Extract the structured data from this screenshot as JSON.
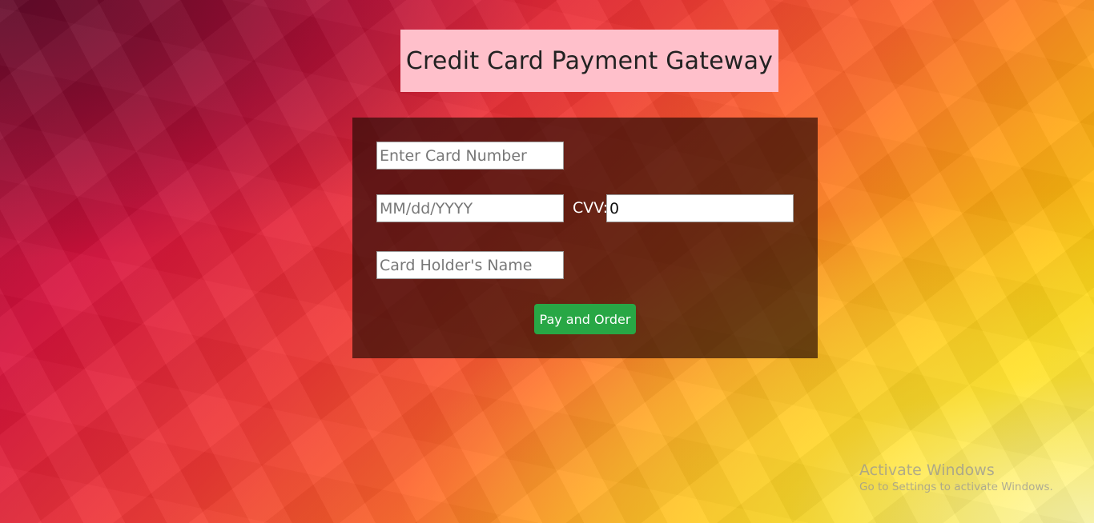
{
  "header": {
    "title": "Credit Card Payment Gateway"
  },
  "form": {
    "card_number": {
      "placeholder": "Enter Card Number",
      "value": ""
    },
    "expiry": {
      "placeholder": "MM/dd/YYYY",
      "value": ""
    },
    "cvv_label": "CVV:",
    "cvv": {
      "value": "0"
    },
    "holder_name": {
      "placeholder": "Card Holder's Name",
      "value": ""
    },
    "submit_label": "Pay and Order"
  },
  "watermark": {
    "title": "Activate Windows",
    "subtitle": "Go to Settings to activate Windows."
  },
  "colors": {
    "title_background": "#ffc0cb",
    "panel_background": "rgba(40,10,5,0.68)",
    "button_background": "#28a745"
  }
}
